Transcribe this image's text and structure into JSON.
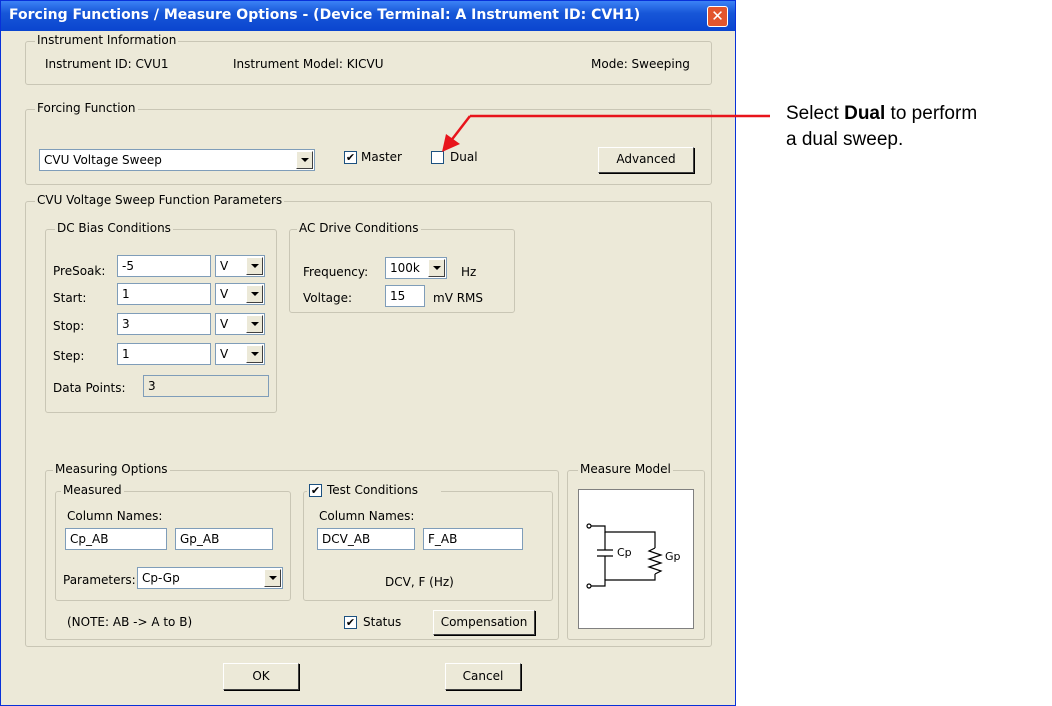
{
  "window": {
    "title": "Forcing Functions / Measure Options - (Device Terminal: A  Instrument ID: CVH1)"
  },
  "instrument_info": {
    "legend": "Instrument Information",
    "id": "Instrument ID:  CVU1",
    "model": "Instrument Model:  KICVU",
    "mode": "Mode:  Sweeping"
  },
  "forcing_function": {
    "legend": "Forcing Function",
    "selected": "CVU Voltage Sweep",
    "master_label": "Master",
    "master_checked": "✔",
    "dual_label": "Dual",
    "dual_checked": "",
    "advanced_label": "Advanced"
  },
  "sweep_params": {
    "legend": "CVU Voltage Sweep Function Parameters",
    "dc_legend": "DC Bias Conditions",
    "presoak_label": "PreSoak:",
    "presoak_value": "-5",
    "presoak_unit": "V",
    "start_label": "Start:",
    "start_value": "1",
    "start_unit": "V",
    "stop_label": "Stop:",
    "stop_value": "3",
    "stop_unit": "V",
    "step_label": "Step:",
    "step_value": "1",
    "step_unit": "V",
    "points_label": "Data Points:",
    "points_value": "3",
    "ac_legend": "AC Drive Conditions",
    "freq_label": "Frequency:",
    "freq_value": "100k",
    "freq_unit": "Hz",
    "volt_label": "Voltage:",
    "volt_value": "15",
    "volt_unit": "mV RMS"
  },
  "measuring": {
    "legend": "Measuring Options",
    "measured_legend": "Measured",
    "column_names_label": "Column Names:",
    "col1": "Cp_AB",
    "col2": "Gp_AB",
    "parameters_label": "Parameters:",
    "parameters_value": "Cp-Gp",
    "note": "(NOTE: AB -> A to B)",
    "test_conditions_label": "Test Conditions",
    "test_conditions_checked": "✔",
    "tc_column_names_label": "Column Names:",
    "tc_col1": "DCV_AB",
    "tc_col2": "F_AB",
    "tc_units": "DCV, F (Hz)",
    "status_label": "Status",
    "status_checked": "✔",
    "compensation_label": "Compensation"
  },
  "measure_model": {
    "legend": "Measure Model",
    "cap_label": "Cp",
    "cond_label": "Gp"
  },
  "footer": {
    "ok_label": "OK",
    "cancel_label": "Cancel"
  },
  "annotation": {
    "line1_pre": "Select ",
    "line1_bold": "Dual",
    "line1_post": " to perform",
    "line2": "a dual sweep.",
    "arrow_color": "#e8141b"
  }
}
